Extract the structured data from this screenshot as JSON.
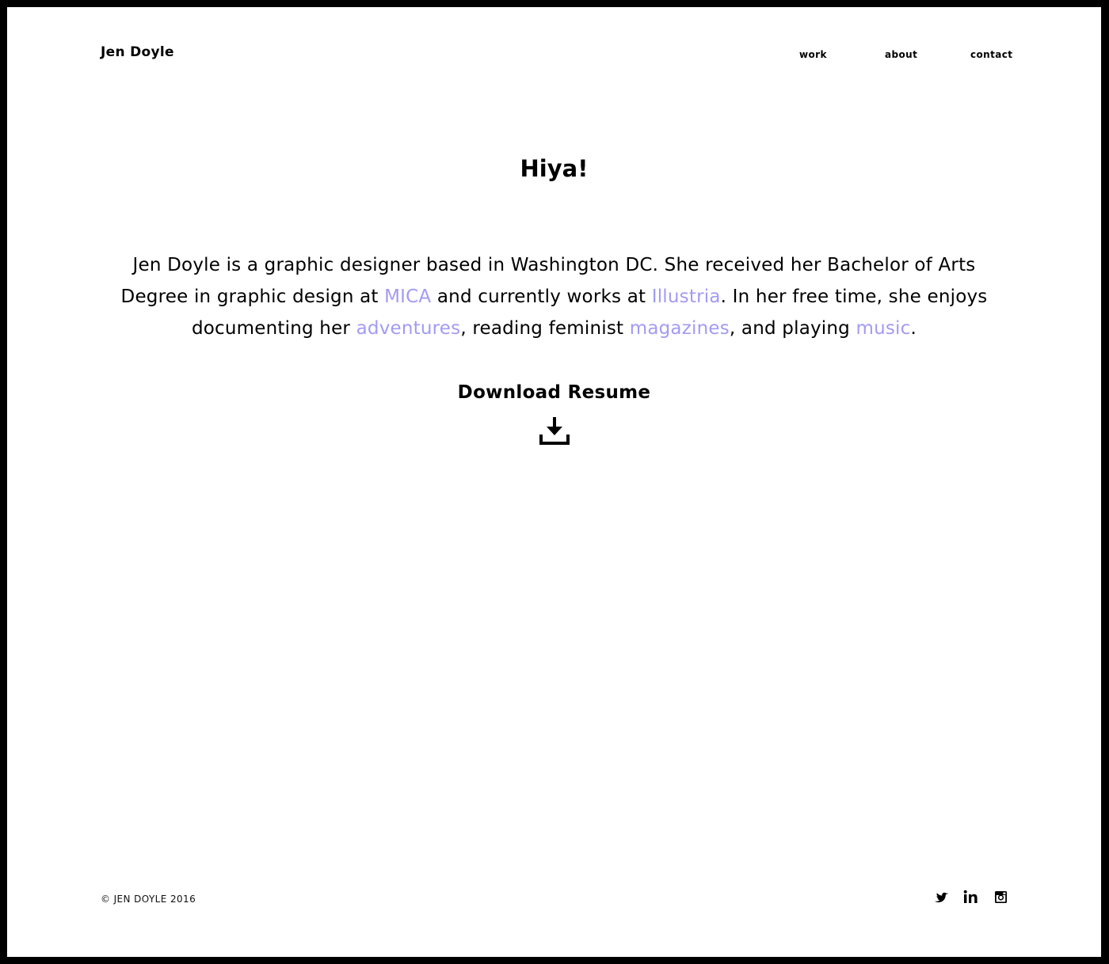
{
  "header": {
    "brand": "Jen Doyle",
    "nav": {
      "work": "work",
      "about": "about",
      "contact": "contact"
    }
  },
  "main": {
    "heading": "Hiya!",
    "bio": {
      "part1": "Jen Doyle is a graphic designer based in Washington DC. She received her Bachelor of Arts Degree in graphic design at ",
      "link_mica": "MICA",
      "part2": " and currently works at ",
      "link_illustria": "Illustria",
      "part3": ". In her free time, she enjoys documenting her ",
      "link_adventures": "adventures",
      "part4": ", reading feminist ",
      "link_magazines": "magazines",
      "part5": ", and playing ",
      "link_music": "music",
      "part6": "."
    },
    "download_label": "Download Resume",
    "download_icon": "download-icon"
  },
  "footer": {
    "copyright": "© JEN DOYLE 2016",
    "social_icons": [
      "twitter-icon",
      "linkedin-icon",
      "instagram-icon"
    ]
  },
  "colors": {
    "background": "#ffffff",
    "frame": "#000000",
    "text": "#000000",
    "link": "#a29bf5"
  }
}
